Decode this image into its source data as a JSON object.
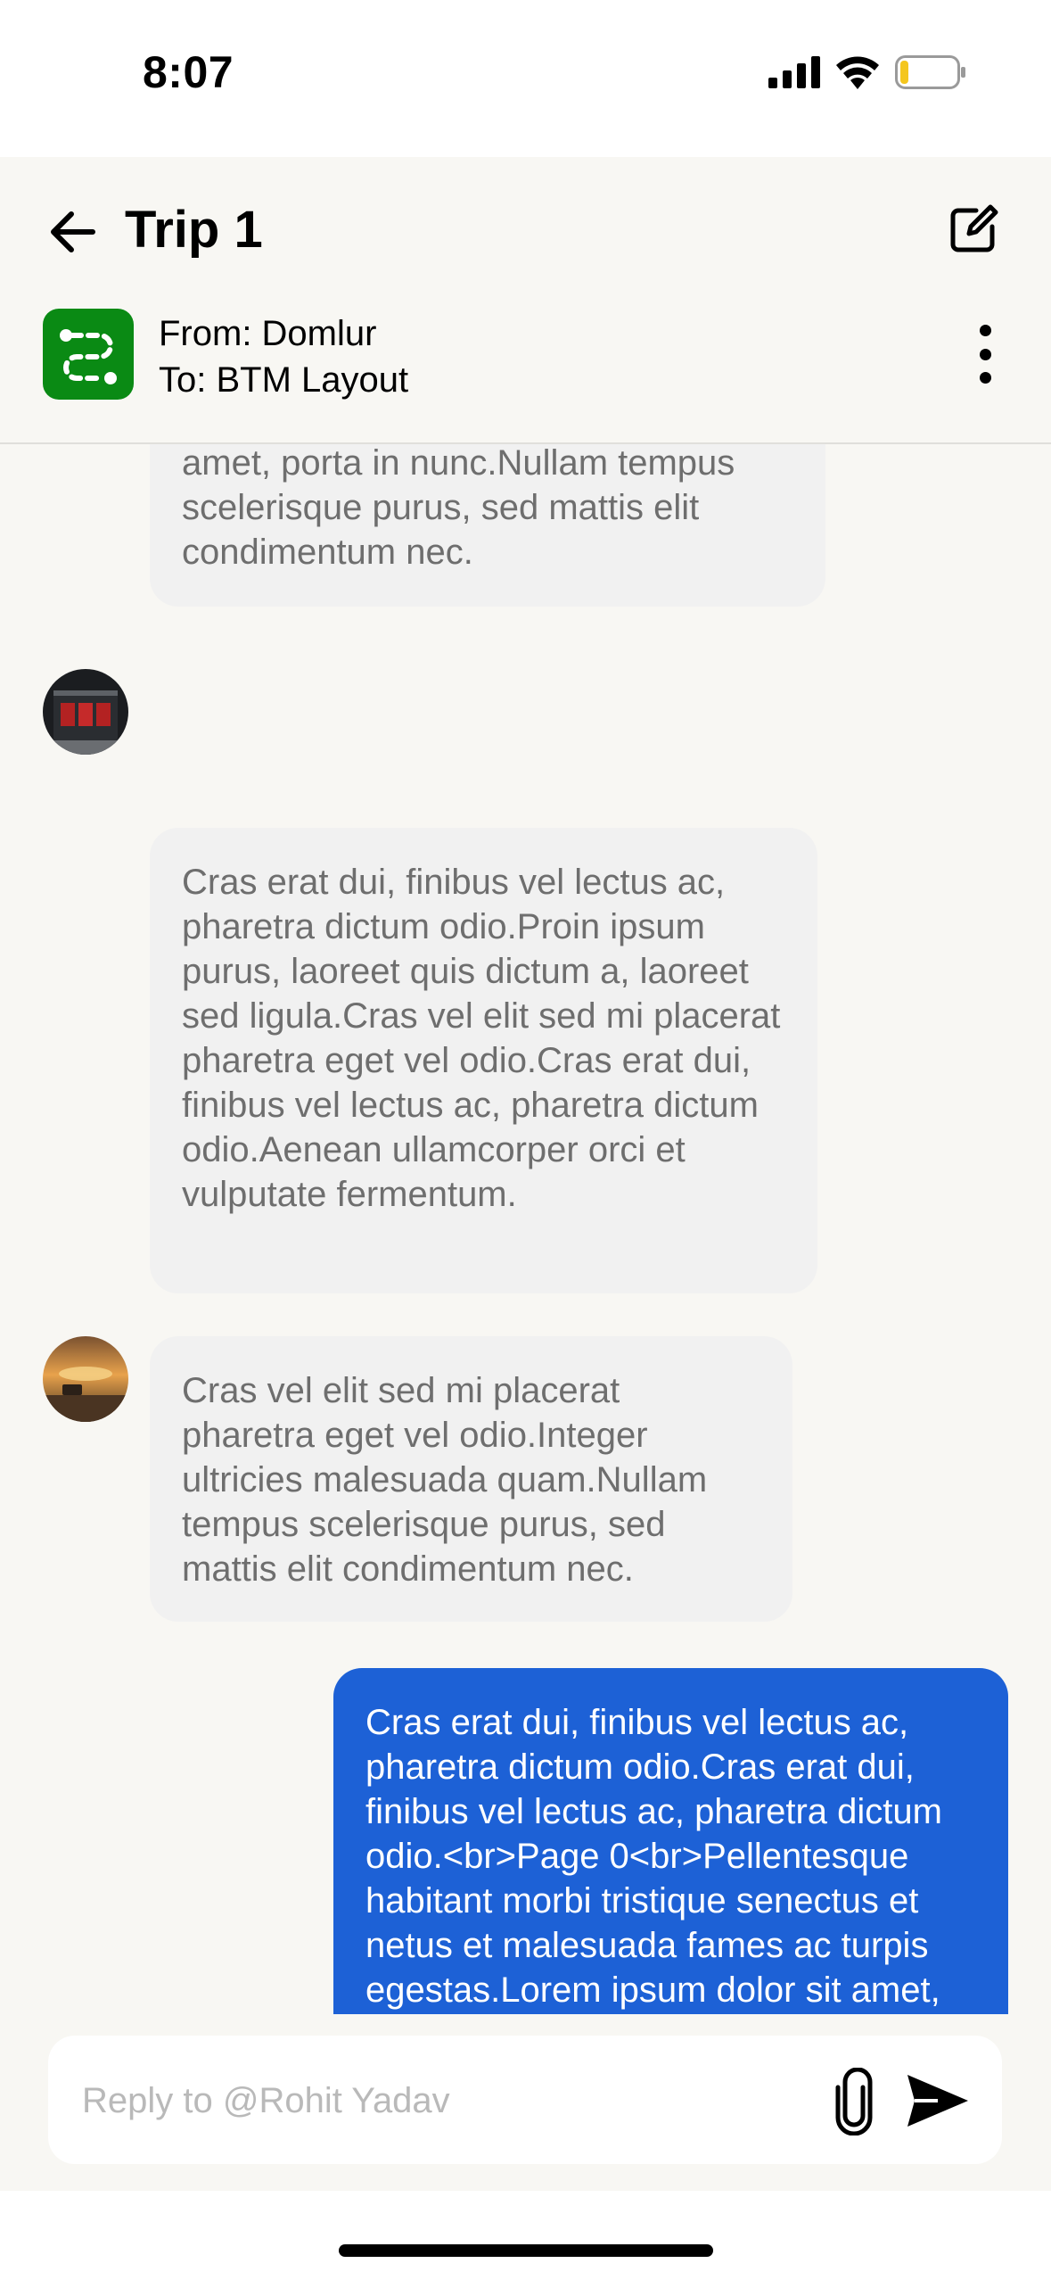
{
  "status_bar": {
    "time": "8:07"
  },
  "header": {
    "title": "Trip 1",
    "route_from": "From: Domlur",
    "route_to": "To: BTM Layout"
  },
  "messages": [
    {
      "direction": "incoming",
      "text": "risus sapien, auctor eu volutpat sit amet, porta in nunc.Nullam tempus scelerisque purus, sed mattis elit condimentum nec."
    },
    {
      "direction": "incoming",
      "avatar": "avatar-red-building",
      "text": "Cras erat dui, finibus vel lectus ac, pharetra dictum odio.Proin ipsum purus, laoreet quis dictum a, laoreet sed ligula.Cras vel elit sed mi placerat pharetra eget vel odio.Cras erat dui, finibus vel lectus ac, pharetra dictum odio.Aenean ullamcorper orci et vulputate fermentum."
    },
    {
      "direction": "incoming",
      "avatar": "avatar-sunset-road",
      "text": "Cras vel elit sed mi placerat pharetra eget vel odio.Integer ultricies malesuada quam.Nullam tempus scelerisque purus, sed mattis elit condimentum nec."
    },
    {
      "direction": "outgoing",
      "text": "Cras erat dui, finibus vel lectus ac, pharetra dictum odio.Cras erat dui, finibus vel lectus ac, pharetra dictum odio.<br>Page 0<br>Pellentesque habitant morbi tristique senectus et netus et malesuada fames ac turpis egestas.Lorem ipsum dolor sit amet, consectetur adipiscing elit."
    }
  ],
  "composer": {
    "placeholder": "Reply to @Rohit Yadav"
  },
  "colors": {
    "accent": "#1d61d6",
    "route_logo": "#0a8a14",
    "incoming_bubble": "#f1f1f1",
    "background": "#f8f7f3"
  }
}
